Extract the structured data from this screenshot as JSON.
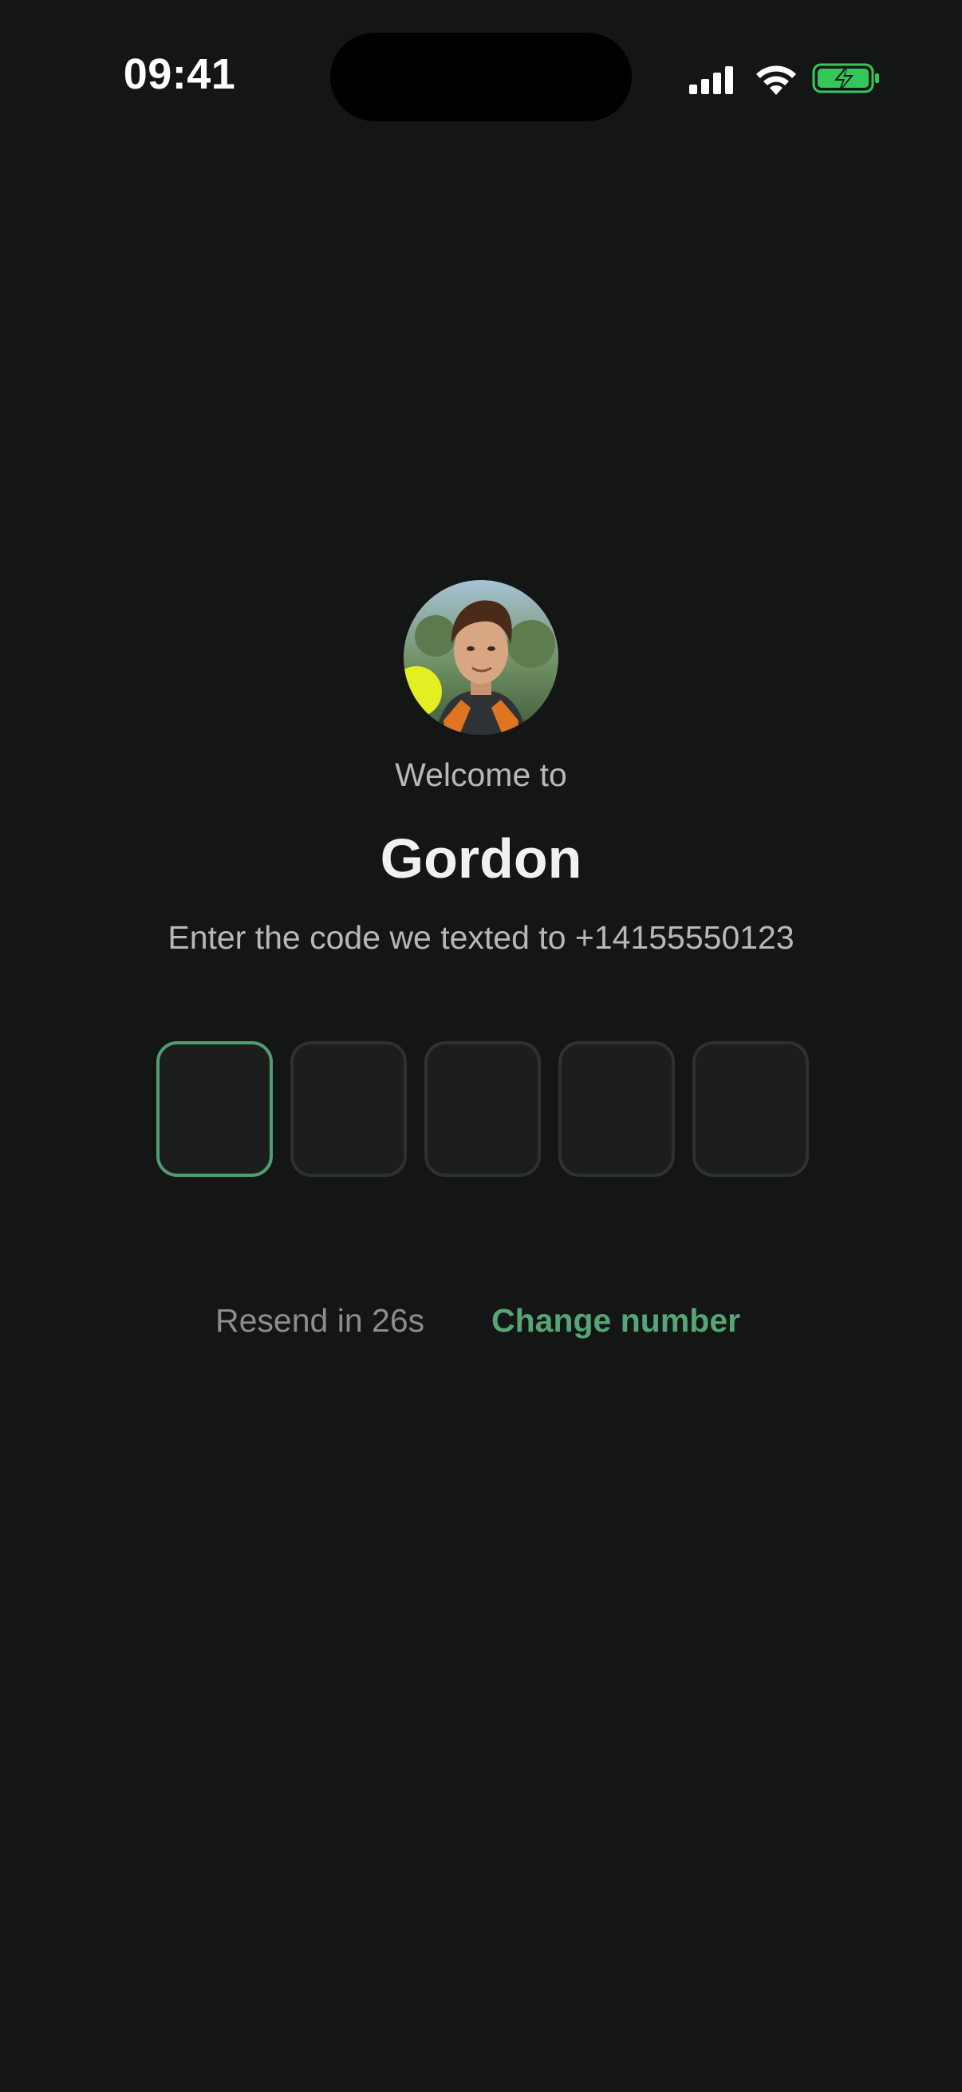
{
  "status_bar": {
    "time": "09:41",
    "icons": [
      "cellular-signal-icon",
      "wifi-icon",
      "battery-charging-icon"
    ],
    "battery_color": "#34c759"
  },
  "welcome": {
    "avatar_icon": "profile-avatar",
    "greeting": "Welcome to",
    "app_name": "Gordon",
    "instruction": "Enter the code we texted to +14155550123"
  },
  "code_entry": {
    "digit_count": 5,
    "active_index": 0,
    "active_border_color": "#4f9d72",
    "inactive_border_color": "#2d3230"
  },
  "footer": {
    "resend_label": "Resend in 26s",
    "change_number_label": "Change number",
    "accent_color": "#55a576"
  }
}
